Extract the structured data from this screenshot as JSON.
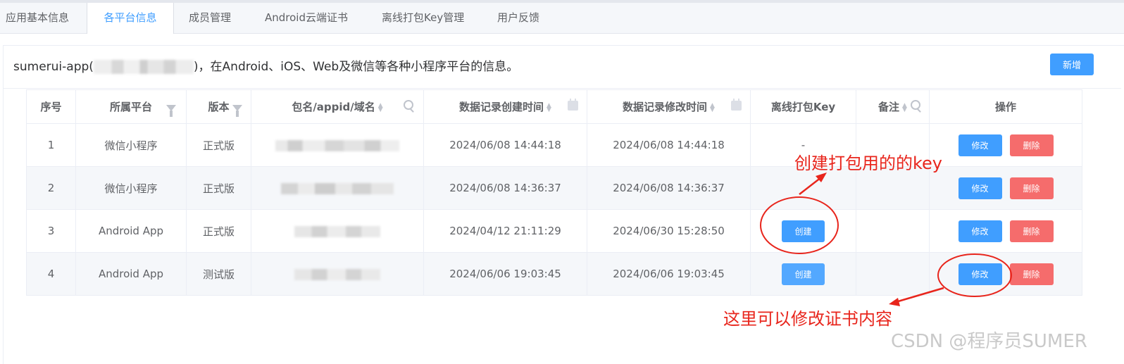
{
  "tabs": [
    {
      "label": "应用基本信息",
      "active": false
    },
    {
      "label": "各平台信息",
      "active": true
    },
    {
      "label": "成员管理",
      "active": false
    },
    {
      "label": "Android云端证书",
      "active": false
    },
    {
      "label": "离线打包Key管理",
      "active": false
    },
    {
      "label": "用户反馈",
      "active": false
    }
  ],
  "header": {
    "prefix": "sumerui-app(",
    "suffix": ")，在Android、iOS、Web及微信等各种小程序平台的信息。",
    "add_button": "新增"
  },
  "table": {
    "columns": [
      "序号",
      "所属平台",
      "版本",
      "包名/appid/域名",
      "数据记录创建时间",
      "数据记录修改时间",
      "离线打包Key",
      "备注",
      "操作"
    ],
    "rows": [
      {
        "index": "1",
        "platform": "微信小程序",
        "version": "正式版",
        "created": "2024/06/08 14:44:18",
        "modified": "2024/06/08 14:44:18",
        "key": "-",
        "note": "",
        "key_button": ""
      },
      {
        "index": "2",
        "platform": "微信小程序",
        "version": "正式版",
        "created": "2024/06/08 14:36:37",
        "modified": "2024/06/08 14:36:37",
        "key": "",
        "note": "",
        "key_button": ""
      },
      {
        "index": "3",
        "platform": "Android App",
        "version": "正式版",
        "created": "2024/04/12 21:11:29",
        "modified": "2024/06/30 15:28:50",
        "key": "",
        "note": "",
        "key_button": "创建"
      },
      {
        "index": "4",
        "platform": "Android App",
        "version": "测试版",
        "created": "2024/06/06 19:03:45",
        "modified": "2024/06/06 19:03:45",
        "key": "",
        "note": "",
        "key_button": "创建"
      }
    ],
    "edit_label": "修改",
    "delete_label": "删除"
  },
  "annotations": {
    "create_key": "创建打包用的的key",
    "edit_cert": "这里可以修改证书内容",
    "color": "#e8251c"
  },
  "watermark": "CSDN @程序员SUMER",
  "colors": {
    "primary": "#409eff",
    "danger": "#f56c6c"
  }
}
